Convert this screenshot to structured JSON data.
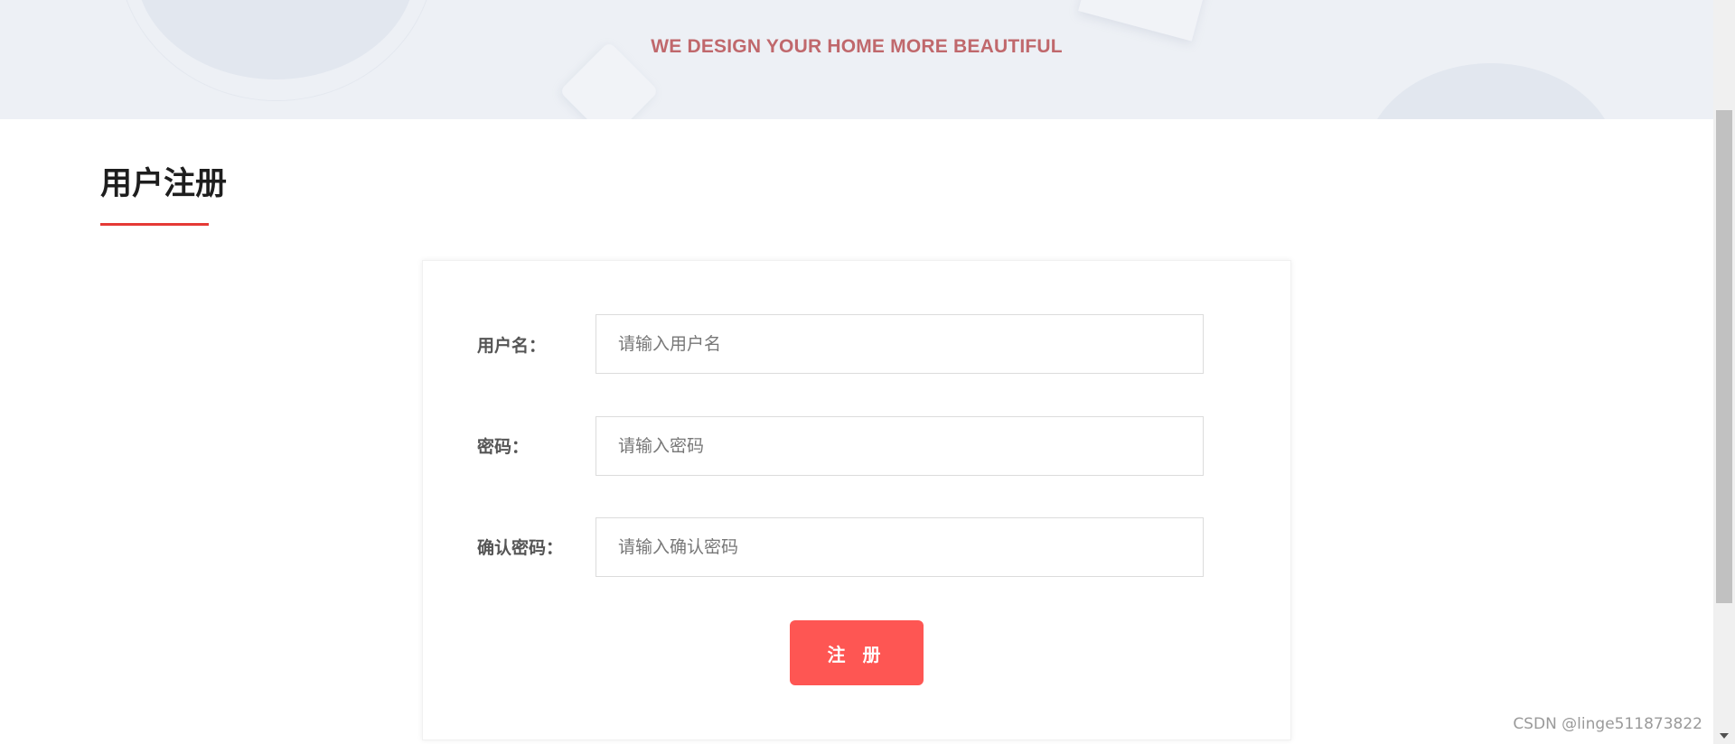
{
  "banner": {
    "tagline": "WE DESIGN YOUR HOME MORE BEAUTIFUL"
  },
  "section": {
    "title": "用户注册"
  },
  "form": {
    "username": {
      "label": "用户名：",
      "placeholder": "请输入用户名"
    },
    "password": {
      "label": "密码：",
      "placeholder": "请输入密码"
    },
    "confirm_password": {
      "label": "确认密码：",
      "placeholder": "请输入确认密码"
    },
    "submit_label": "注 册"
  },
  "watermark": "CSDN @linge511873822",
  "colors": {
    "accent": "#fe5653",
    "underline": "#e53a36",
    "tagline": "#c0686c",
    "banner_bg": "#edf0f5"
  }
}
